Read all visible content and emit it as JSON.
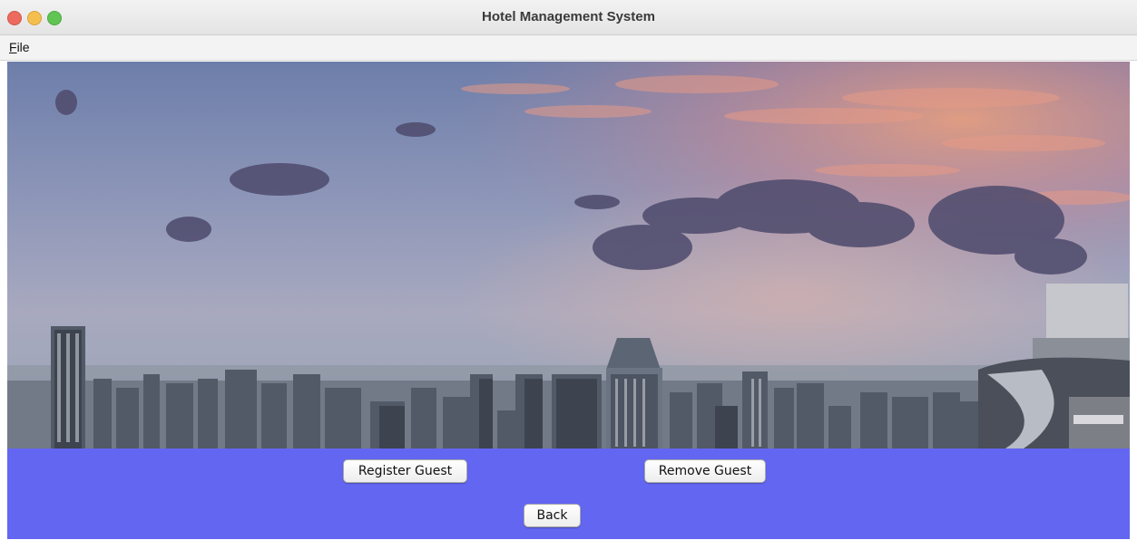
{
  "window": {
    "title": "Hotel Management System"
  },
  "menu": {
    "file_mnemonic": "F",
    "file_rest": "ile"
  },
  "buttons": {
    "register": "Register Guest",
    "remove": "Remove Guest",
    "back": "Back"
  },
  "colors": {
    "panel_background": "#6366f1",
    "close": "#ec6a5e",
    "minimize": "#f4bf4f",
    "maximize": "#61c554"
  },
  "images": {
    "background": "panoramic city skyline at dusk under a cloudy pink and blue sky"
  }
}
